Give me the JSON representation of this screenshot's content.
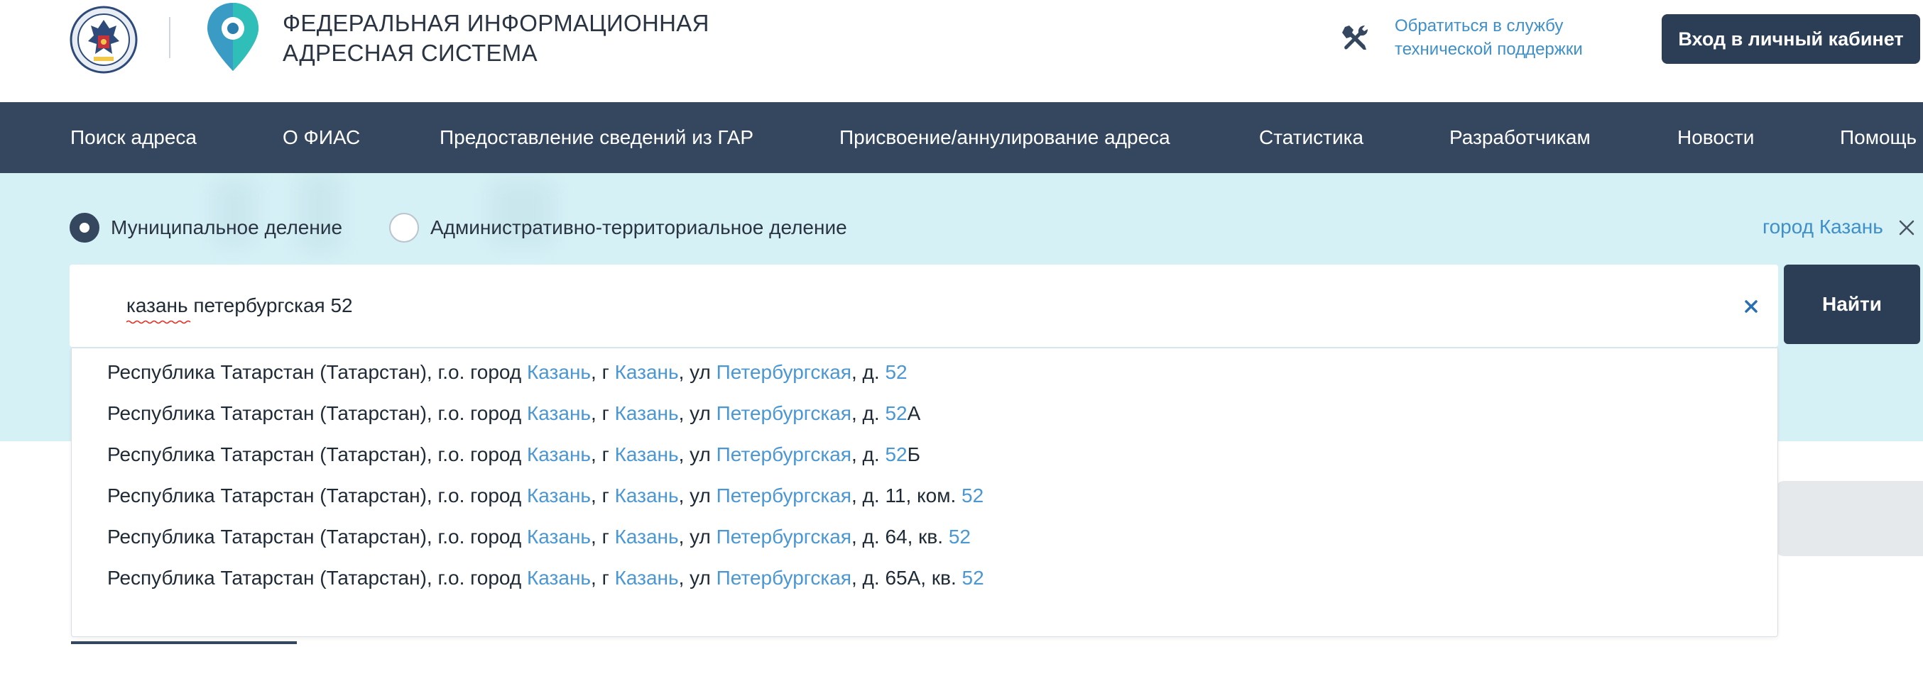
{
  "header": {
    "title_line1": "ФЕДЕРАЛЬНАЯ ИНФОРМАЦИОННАЯ",
    "title_line2": "АДРЕСНАЯ СИСТЕМА",
    "support_line1": "Обратиться в службу",
    "support_line2": "технической поддержки",
    "login_label": "Вход в личный кабинет"
  },
  "nav": {
    "items": [
      "Поиск адреса",
      "О ФИАС",
      "Предоставление сведений из ГАР",
      "Присвоение/аннулирование адреса",
      "Статистика",
      "Разработчикам",
      "Новости",
      "Помощь"
    ]
  },
  "search": {
    "radio_municipal": "Муниципальное деление",
    "radio_admin": "Административно-территориальное деление",
    "selected_mode": "Муниципальное деление",
    "region_filter": "город Казань",
    "query": "казань петербургская 52",
    "find_label": "Найти"
  },
  "suggestions": [
    {
      "prefix": "Республика Татарстан (Татарстан), г.о. город ",
      "city1": "Казань",
      "mid1": ", г ",
      "city2": "Казань",
      "mid2": ", ул ",
      "street": "Петербургская",
      "mid3": ", д. ",
      "num": "52",
      "suffix": ""
    },
    {
      "prefix": "Республика Татарстан (Татарстан), г.о. город ",
      "city1": "Казань",
      "mid1": ", г ",
      "city2": "Казань",
      "mid2": ", ул ",
      "street": "Петербургская",
      "mid3": ", д. ",
      "num": "52",
      "suffix": "А"
    },
    {
      "prefix": "Республика Татарстан (Татарстан), г.о. город ",
      "city1": "Казань",
      "mid1": ", г ",
      "city2": "Казань",
      "mid2": ", ул ",
      "street": "Петербургская",
      "mid3": ", д. ",
      "num": "52",
      "suffix": "Б"
    },
    {
      "prefix": "Республика Татарстан (Татарстан), г.о. город ",
      "city1": "Казань",
      "mid1": ", г ",
      "city2": "Казань",
      "mid2": ", ул ",
      "street": "Петербургская",
      "mid3": ", д. 11, ком. ",
      "num": "52",
      "suffix": ""
    },
    {
      "prefix": "Республика Татарстан (Татарстан), г.о. город ",
      "city1": "Казань",
      "mid1": ", г ",
      "city2": "Казань",
      "mid2": ", ул ",
      "street": "Петербургская",
      "mid3": ", д. 64, кв. ",
      "num": "52",
      "suffix": ""
    },
    {
      "prefix": "Республика Татарстан (Татарстан), г.о. город ",
      "city1": "Казань",
      "mid1": ", г ",
      "city2": "Казань",
      "mid2": ", ул ",
      "street": "Петербургская",
      "mid3": ", д. 65А, кв. ",
      "num": "52",
      "suffix": ""
    }
  ],
  "icons": {
    "emblem": "fns-emblem-icon",
    "logo": "map-pin-logo-icon",
    "support": "tools-icon",
    "region_close": "close-icon",
    "clear": "clear-icon"
  },
  "colors": {
    "nav_bg": "#34475f",
    "button_bg": "#2c3e56",
    "search_bg": "#d6f1f6",
    "link": "#3f8fc8",
    "highlight": "#4a97d4"
  }
}
